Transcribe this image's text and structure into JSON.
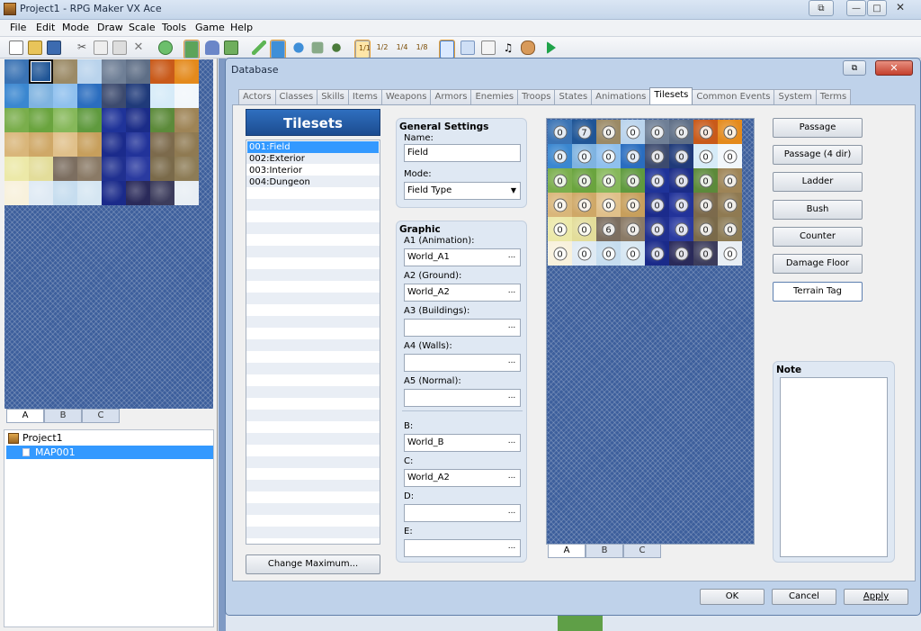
{
  "app": {
    "title": "Project1 - RPG Maker VX Ace"
  },
  "window_controls": {
    "restore": "⧉",
    "minimize": "—",
    "maximize": "□",
    "close": "✕"
  },
  "menu": [
    "File",
    "Edit",
    "Mode",
    "Draw",
    "Scale",
    "Tools",
    "Game",
    "Help"
  ],
  "toolbar": {
    "icons": [
      "new-icon",
      "open-icon",
      "save-icon",
      "cut-icon",
      "copy-icon",
      "paste-icon",
      "delete-icon",
      "undo-icon",
      "map-layer-icon",
      "event-layer-icon",
      "region-icon",
      "pencil-icon",
      "rectangle-icon",
      "ellipse-icon",
      "flood-fill-icon",
      "shadow-pen-icon",
      "scale-1-1-icon",
      "scale-1-2-icon",
      "scale-1-4-icon",
      "scale-1-8-icon",
      "database-icon",
      "resource-manager-icon",
      "script-editor-icon",
      "sound-test-icon",
      "character-generator-icon",
      "playtest-icon"
    ],
    "scale_labels": [
      "1/1",
      "1/2",
      "1/4",
      "1/8"
    ]
  },
  "left_panel": {
    "palette_tabs": [
      "A",
      "B",
      "C"
    ],
    "active_tab": "A",
    "project_name": "Project1",
    "maps": [
      "MAP001"
    ]
  },
  "dialog": {
    "title": "Database",
    "minimize": "⧉",
    "close": "✕",
    "tabs": [
      "Actors",
      "Classes",
      "Skills",
      "Items",
      "Weapons",
      "Armors",
      "Enemies",
      "Troops",
      "States",
      "Animations",
      "Tilesets",
      "Common Events",
      "System",
      "Terms"
    ],
    "active_tab": "Tilesets",
    "tileset_list": {
      "header": "Tilesets",
      "items": [
        "001:Field",
        "002:Exterior",
        "003:Interior",
        "004:Dungeon"
      ],
      "selected": "001:Field",
      "change_max_button": "Change Maximum..."
    },
    "general": {
      "header": "General Settings",
      "name_label": "Name:",
      "name_value": "Field",
      "mode_label": "Mode:",
      "mode_value": "Field Type"
    },
    "graphic": {
      "header": "Graphic",
      "fields": [
        {
          "label": "A1 (Animation):",
          "value": "World_A1"
        },
        {
          "label": "A2 (Ground):",
          "value": "World_A2"
        },
        {
          "label": "A3 (Buildings):",
          "value": ""
        },
        {
          "label": "A4 (Walls):",
          "value": ""
        },
        {
          "label": "A5 (Normal):",
          "value": ""
        },
        {
          "label": "B:",
          "value": "World_B"
        },
        {
          "label": "C:",
          "value": "World_A2"
        },
        {
          "label": "D:",
          "value": ""
        },
        {
          "label": "E:",
          "value": ""
        }
      ],
      "browse": "..."
    },
    "preview": {
      "tabs": [
        "A",
        "B",
        "C"
      ],
      "active_tab": "A",
      "passage_values": [
        [
          "0",
          "7",
          "0",
          "0",
          "0",
          "0",
          "0",
          "0"
        ],
        [
          "0",
          "0",
          "0",
          "0",
          "0",
          "0",
          "0",
          "0"
        ],
        [
          "0",
          "0",
          "0",
          "0",
          "0",
          "0",
          "0",
          "0"
        ],
        [
          "0",
          "0",
          "0",
          "0",
          "0",
          "0",
          "0",
          "0"
        ],
        [
          "0",
          "0",
          "6",
          "0",
          "0",
          "0",
          "0",
          "0"
        ],
        [
          "0",
          "0",
          "0",
          "0",
          "0",
          "0",
          "0",
          "0"
        ]
      ]
    },
    "mode_buttons": [
      "Passage",
      "Passage (4 dir)",
      "Ladder",
      "Bush",
      "Counter",
      "Damage Floor",
      "Terrain Tag"
    ],
    "active_mode": "Terrain Tag",
    "note_label": "Note",
    "note_value": "",
    "footer_buttons": {
      "ok": "OK",
      "cancel": "Cancel",
      "apply": "Apply"
    }
  },
  "colors": {
    "selection": "#3399ff",
    "dialog_frame": "#bfd2ea",
    "palette_bg": "#3d5f9c"
  }
}
